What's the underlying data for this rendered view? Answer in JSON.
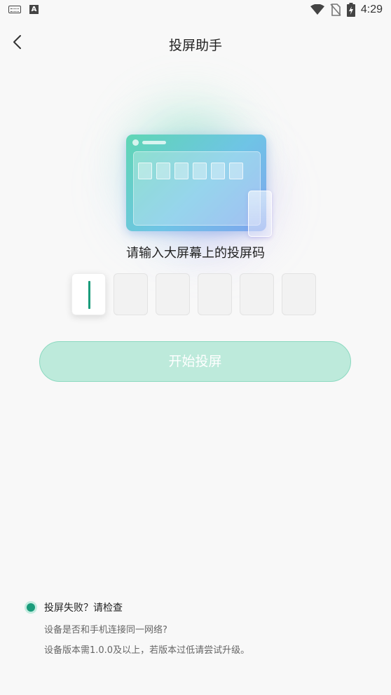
{
  "status_bar": {
    "time": "4:29",
    "left_icons": [
      "keyboard-icon",
      "a-badge-icon"
    ],
    "right_icons": [
      "wifi-icon",
      "no-sim-icon",
      "battery-charging-icon"
    ]
  },
  "header": {
    "title": "投屏助手",
    "back_icon": "chevron-left-icon"
  },
  "main": {
    "prompt": "请输入大屏幕上的投屏码",
    "code_boxes": [
      "",
      "",
      "",
      "",
      "",
      ""
    ],
    "active_box_index": 0,
    "start_button_label": "开始投屏"
  },
  "tips": {
    "title": "投屏失败？请检查",
    "line1": "设备是否和手机连接同一网络?",
    "line2": "设备版本需1.0.0及以上，若版本过低请尝试升级。"
  },
  "colors": {
    "accent": "#1a9c7b",
    "button_bg": "#bdeadb",
    "background": "#f8f8f8"
  }
}
